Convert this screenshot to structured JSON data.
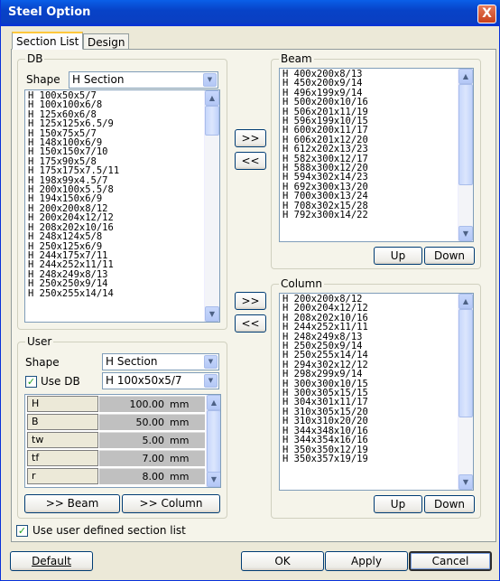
{
  "title": "Steel Option",
  "close_glyph": "X",
  "tabs": [
    "Section List",
    "Design"
  ],
  "db": {
    "legend": "DB",
    "shape_label": "Shape",
    "shape_value": "H Section",
    "items": [
      "H 100x50x5/7",
      "H 100x100x6/8",
      "H 125x60x6/8",
      "H 125x125x6.5/9",
      "H 150x75x5/7",
      "H 148x100x6/9",
      "H 150x150x7/10",
      "H 175x90x5/8",
      "H 175x175x7.5/11",
      "H 198x99x4.5/7",
      "H 200x100x5.5/8",
      "H 194x150x6/9",
      "H 200x200x8/12",
      "H 200x204x12/12",
      "H 208x202x10/16",
      "H 248x124x5/8",
      "H 250x125x6/9",
      "H 244x175x7/11",
      "H 244x252x11/11",
      "H 248x249x8/13",
      "H 250x250x9/14",
      "H 250x255x14/14"
    ]
  },
  "move_buttons": {
    "add": ">>",
    "remove": "<<"
  },
  "beam": {
    "legend": "Beam",
    "items": [
      "H 400x200x8/13",
      "H 450x200x9/14",
      "H 496x199x9/14",
      "H 500x200x10/16",
      "H 506x201x11/19",
      "H 596x199x10/15",
      "H 600x200x11/17",
      "H 606x201x12/20",
      "H 612x202x13/23",
      "H 582x300x12/17",
      "H 588x300x12/20",
      "H 594x302x14/23",
      "H 692x300x13/20",
      "H 700x300x13/24",
      "H 708x302x15/28",
      "H 792x300x14/22"
    ],
    "up_label": "Up",
    "down_label": "Down"
  },
  "column": {
    "legend": "Column",
    "items": [
      "H 200x200x8/12",
      "H 200x204x12/12",
      "H 208x202x10/16",
      "H 244x252x11/11",
      "H 248x249x8/13",
      "H 250x250x9/14",
      "H 250x255x14/14",
      "H 294x302x12/12",
      "H 298x299x9/14",
      "H 300x300x10/15",
      "H 300x305x15/15",
      "H 304x301x11/17",
      "H 310x305x15/20",
      "H 310x310x20/20",
      "H 344x348x10/16",
      "H 344x354x16/16",
      "H 350x350x12/19",
      "H 350x357x19/19"
    ],
    "up_label": "Up",
    "down_label": "Down"
  },
  "user": {
    "legend": "User",
    "shape_label": "Shape",
    "shape_value": "H Section",
    "use_db_label": "Use DB",
    "use_db_checked": true,
    "db_value": "H 100x50x5/7",
    "params": [
      {
        "name": "H",
        "value": "100.00",
        "unit": "mm"
      },
      {
        "name": "B",
        "value": "50.00",
        "unit": "mm"
      },
      {
        "name": "tw",
        "value": "5.00",
        "unit": "mm"
      },
      {
        "name": "tf",
        "value": "7.00",
        "unit": "mm"
      },
      {
        "name": "r",
        "value": "8.00",
        "unit": "mm"
      }
    ],
    "to_beam_label": ">> Beam",
    "to_column_label": ">> Column"
  },
  "use_user_defined_label": "Use user defined section list",
  "use_user_defined_checked": true,
  "footer": {
    "default_label": "Default",
    "ok_label": "OK",
    "apply_label": "Apply",
    "cancel_label": "Cancel"
  }
}
